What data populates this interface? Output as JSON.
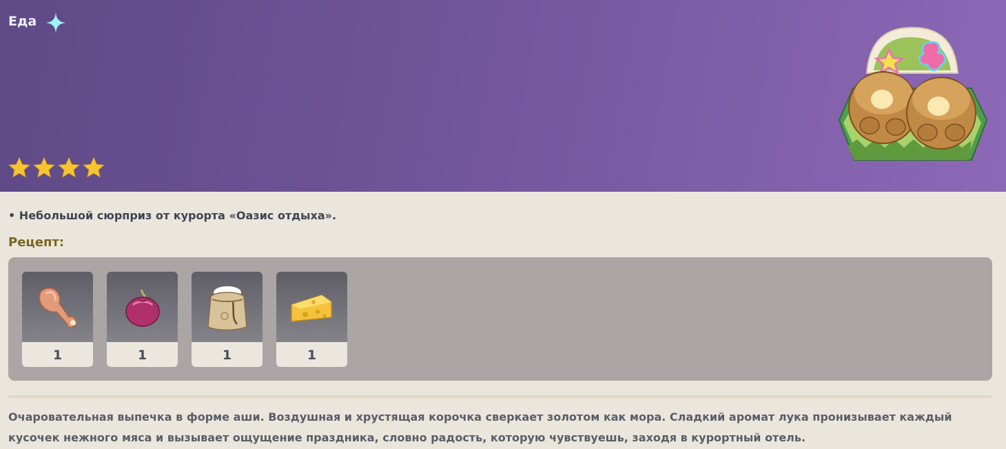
{
  "header": {
    "category": "Еда",
    "rarity_stars": 4,
    "colors": {
      "gradient_start": "#5e4a86",
      "gradient_end": "#8d68b7",
      "star": "#f7c531"
    }
  },
  "item": {
    "bullet_description": "• Небольшой сюрприз от курорта «Оазис отдыха».",
    "flavor_text": "Очаровательная выпечка в форме аши. Воздушная и хрустящая корочка сверкает золотом как мора. Сладкий аромат лука пронизывает каждый кусочек нежного мяса и вызывает ощущение праздника, словно радость, которую чувствуешь, заходя в курортный отель."
  },
  "recipe": {
    "title": "Рецепт:",
    "ingredients": [
      {
        "icon": "raw-meat-icon",
        "count": "1"
      },
      {
        "icon": "onion-icon",
        "count": "1"
      },
      {
        "icon": "flour-sack-icon",
        "count": "1"
      },
      {
        "icon": "cheese-icon",
        "count": "1"
      }
    ]
  }
}
